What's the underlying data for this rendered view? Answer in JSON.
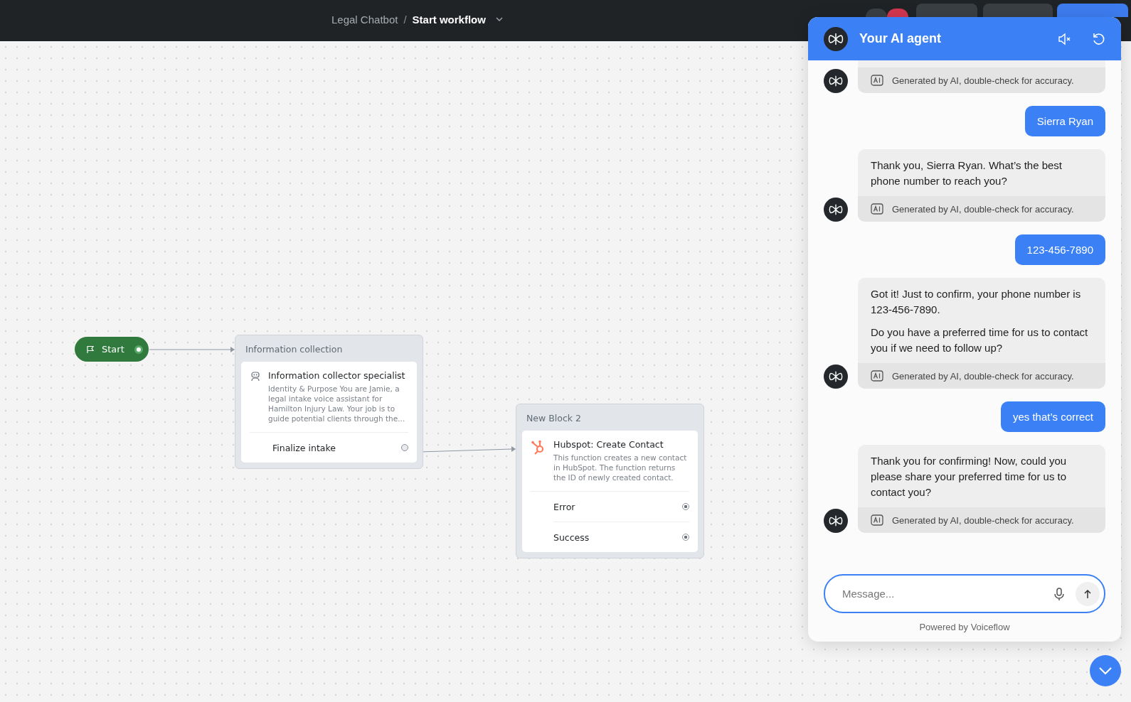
{
  "topbar": {
    "separator": "/",
    "breadcrumb": [
      {
        "label": "Legal Chatbot",
        "current": false
      },
      {
        "label": "Start workflow",
        "current": true
      }
    ]
  },
  "canvas": {
    "start": {
      "label": "Start"
    },
    "blocks": [
      {
        "title": "Information collection",
        "kind": "agent",
        "step_title": "Information collector specialist",
        "description": "Identity & Purpose You are Jamie, a legal intake voice assistant for Hamilton Injury Law. Your job is to guide potential clients through the...",
        "ports": [
          {
            "label": "Finalize intake",
            "connected": true
          }
        ]
      },
      {
        "title": "New Block 2",
        "kind": "function",
        "step_title": "Hubspot: Create Contact",
        "description": "This function creates a new contact in HubSpot. The function returns the ID of newly created contact.",
        "ports": [
          {
            "label": "Error",
            "connected": false
          },
          {
            "label": "Success",
            "connected": false
          }
        ]
      }
    ]
  },
  "chat": {
    "title": "Your AI agent",
    "messages": [
      {
        "kind": "agent",
        "disclaimer": "Generated by AI, double-check for accuracy."
      },
      {
        "kind": "user",
        "text": "Sierra Ryan"
      },
      {
        "kind": "agent",
        "paragraphs": [
          "Thank you, Sierra Ryan. What’s the best phone number to reach you?"
        ],
        "disclaimer": "Generated by AI, double-check for accuracy."
      },
      {
        "kind": "user",
        "text": "123-456-7890"
      },
      {
        "kind": "agent",
        "paragraphs": [
          "Got it! Just to confirm, your phone number is 123-456-7890.",
          "Do you have a preferred time for us to contact you if we need to follow up?"
        ],
        "disclaimer": "Generated by AI, double-check for accuracy."
      },
      {
        "kind": "user",
        "text": "yes that’s correct"
      },
      {
        "kind": "agent",
        "paragraphs": [
          "Thank you for confirming! Now, could you please share your preferred time for us to contact you?"
        ],
        "disclaimer": "Generated by AI, double-check for accuracy."
      }
    ],
    "input": {
      "placeholder": "Message..."
    },
    "footer": "Powered by Voiceflow"
  }
}
